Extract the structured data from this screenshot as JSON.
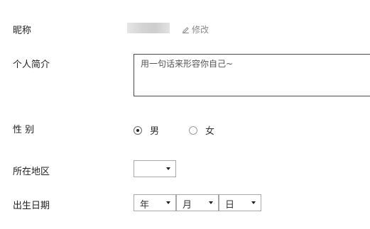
{
  "nickname": {
    "label": "昵称",
    "edit_label": "修改",
    "edit_icon": "pencil-icon"
  },
  "bio": {
    "label": "个人简介",
    "placeholder": "用一句话来形容你自己~"
  },
  "gender": {
    "label": "性 别",
    "options": [
      {
        "label": "男",
        "selected": true
      },
      {
        "label": "女",
        "selected": false
      }
    ]
  },
  "region": {
    "label": "所在地区",
    "selected": ""
  },
  "birthday": {
    "label": "出生日期",
    "year": "年",
    "month": "月",
    "day": "日"
  }
}
